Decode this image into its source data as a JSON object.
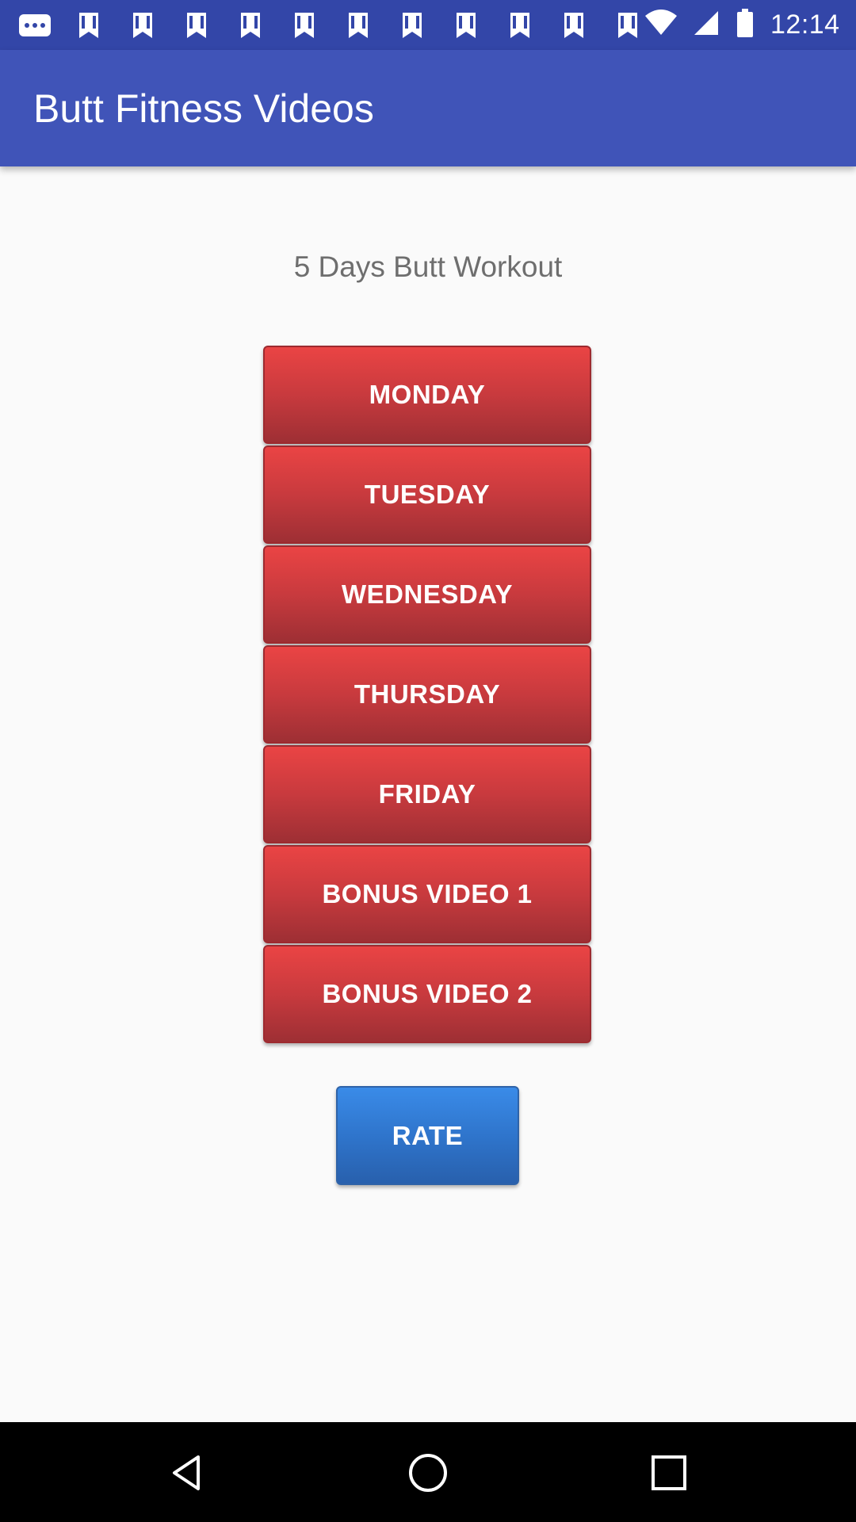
{
  "status_bar": {
    "time": "12:14",
    "notification_icons": [
      "more-dots-icon",
      "notification-icon",
      "notification-icon",
      "notification-icon",
      "notification-icon",
      "notification-icon",
      "notification-icon",
      "notification-icon",
      "notification-icon",
      "notification-icon",
      "notification-icon",
      "notification-icon"
    ],
    "wifi_icon": "wifi-icon",
    "signal_icon": "signal-icon",
    "battery_icon": "battery-icon"
  },
  "app_bar": {
    "title": "Butt Fitness Videos"
  },
  "main": {
    "subtitle": "5 Days Butt Workout",
    "day_buttons": [
      "MONDAY",
      "TUESDAY",
      "WEDNESDAY",
      "THURSDAY",
      "FRIDAY",
      "BONUS VIDEO 1",
      "BONUS VIDEO 2"
    ],
    "rate_label": "RATE"
  },
  "nav_bar": {
    "back_icon": "back-icon",
    "home_icon": "home-icon",
    "recents_icon": "recents-icon"
  },
  "colors": {
    "status_bar": "#3346a8",
    "app_bar": "#4054b8",
    "day_button": "#d43e40",
    "rate_button": "#2f75cc",
    "background": "#fafafa"
  }
}
